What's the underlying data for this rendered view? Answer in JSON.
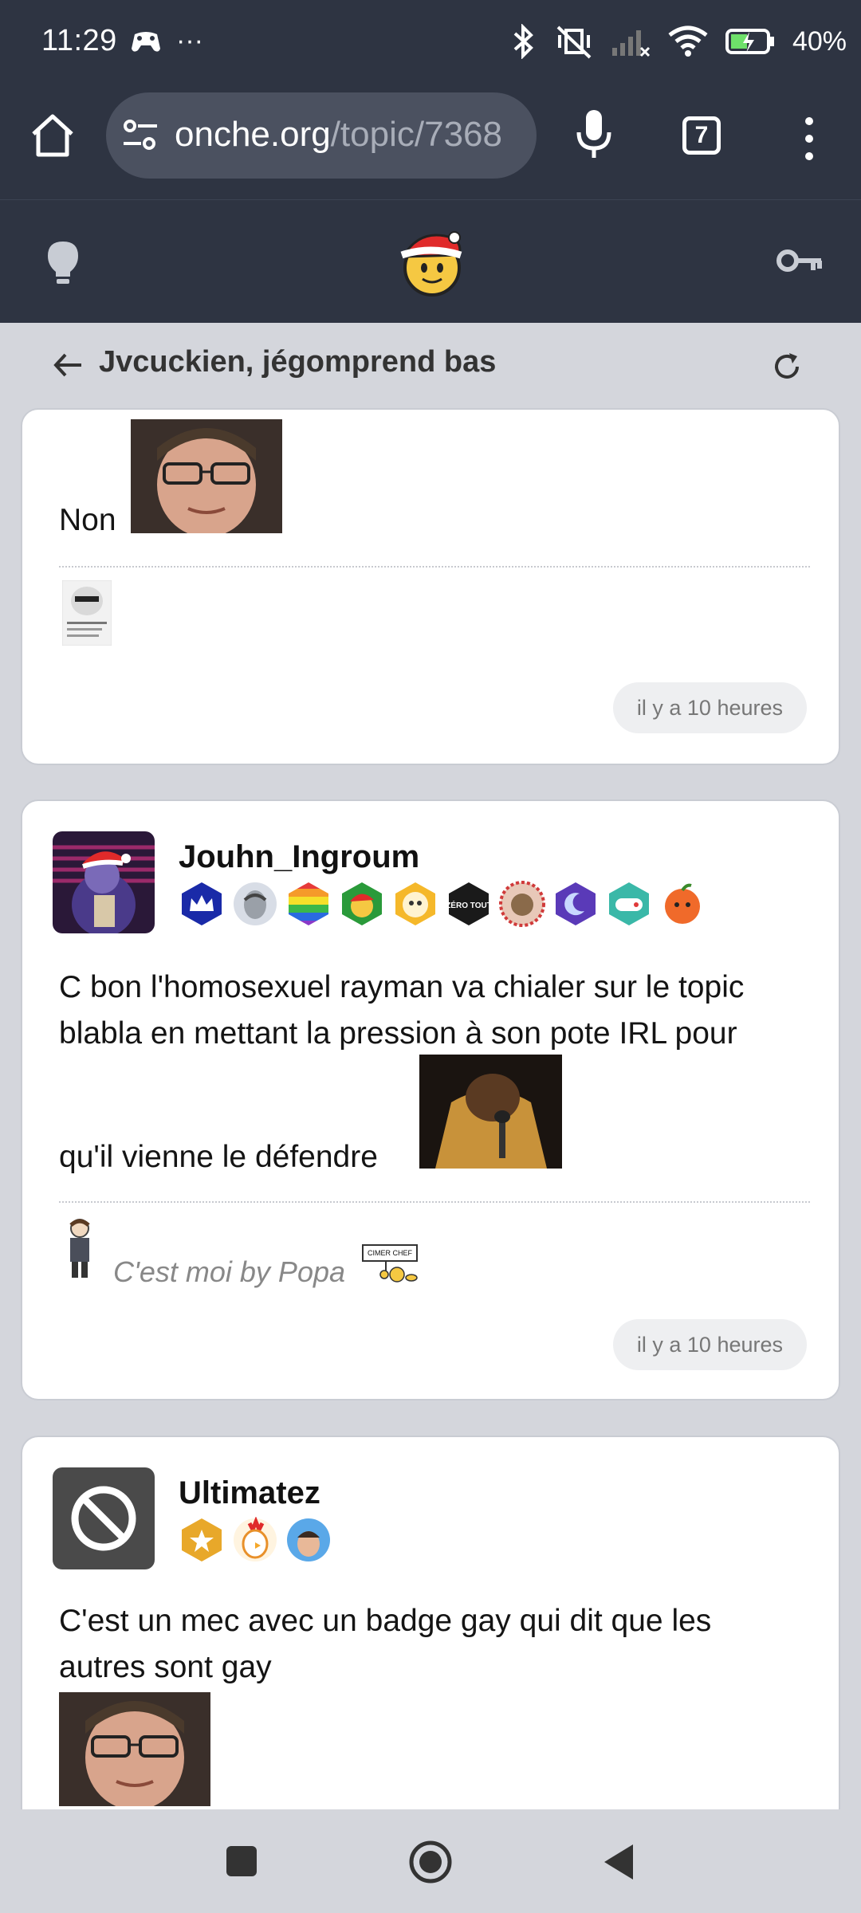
{
  "status": {
    "time": "11:29",
    "more": "···",
    "battery": "40%"
  },
  "browser": {
    "url_main": "onche.org",
    "url_path": "/topic/7368",
    "tab_count": "7"
  },
  "topic": {
    "title": "Jvcuckien, jégomprend bas"
  },
  "posts": [
    {
      "text": "Non",
      "timestamp": "il y a 10 heures"
    },
    {
      "author": "Jouhn_Ingroum",
      "text_line1": "C bon l'homosexuel rayman va chialer sur le topic",
      "text_line2": "blabla en mettant la pression à son pote IRL pour",
      "text_line3": "qu'il vienne le défendre",
      "signature": "C'est moi by Popa",
      "sign_label": "CIMER CHEF",
      "zero_badge": "ZÉRO TOUT",
      "timestamp": "il y a 10 heures"
    },
    {
      "author": "Ultimatez",
      "text_line1": "C'est un mec avec un badge gay qui dit que les",
      "text_line2": "autres sont gay"
    }
  ],
  "colors": {
    "chrome": "#2e3442",
    "page_bg": "#d4d6dc",
    "card_bg": "#ffffff"
  }
}
